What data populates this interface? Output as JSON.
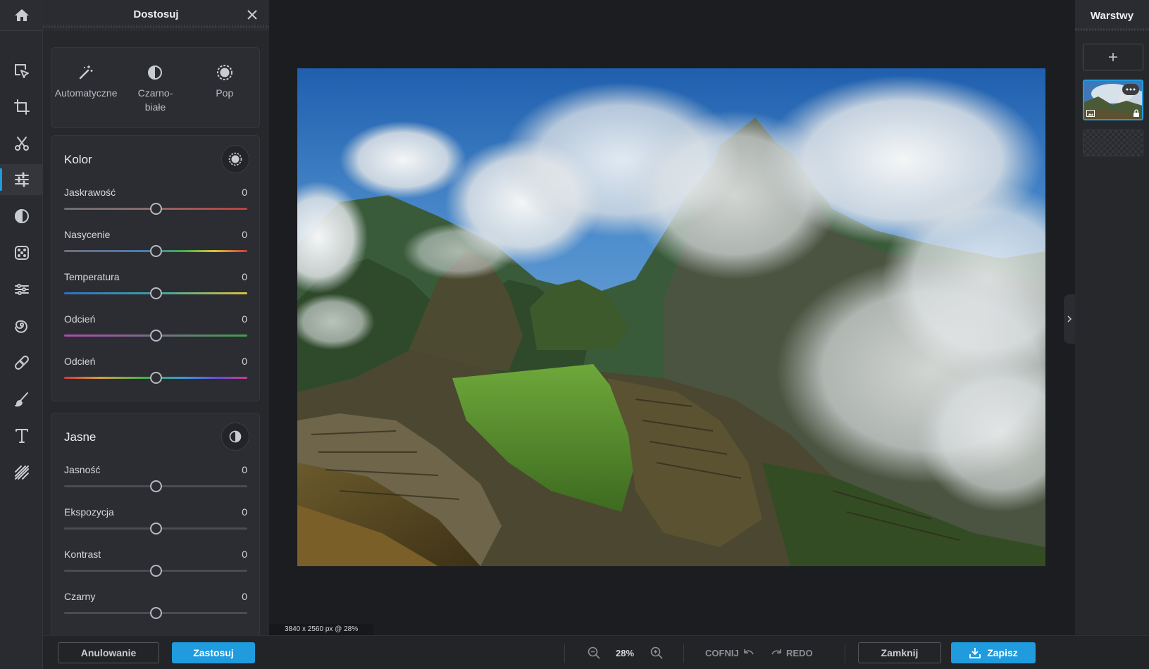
{
  "colors": {
    "accent": "#1f9bde",
    "panel": "#26282c",
    "canvas": "#1c1d21"
  },
  "rail": {
    "items": [
      {
        "icon": "home-icon"
      },
      {
        "icon": "select-arrow-icon"
      },
      {
        "icon": "crop-icon"
      },
      {
        "icon": "scissors-icon"
      },
      {
        "icon": "adjust-sliders-icon",
        "active": true
      },
      {
        "icon": "contrast-circle-icon"
      },
      {
        "icon": "effects-icon"
      },
      {
        "icon": "filters-icon"
      },
      {
        "icon": "liquify-swirl-icon"
      },
      {
        "icon": "bandage-icon"
      },
      {
        "icon": "brush-icon"
      },
      {
        "icon": "text-icon"
      },
      {
        "icon": "pattern-icon"
      }
    ]
  },
  "panel": {
    "title": "Dostosuj",
    "presets": [
      {
        "label": "Automatyczne",
        "icon": "magic-wand-icon"
      },
      {
        "label": "Czarno-białe",
        "line1": "Czarno-",
        "line2": "białe",
        "icon": "half-circle-icon"
      },
      {
        "label": "Pop",
        "icon": "sun-icon"
      }
    ],
    "color_section": {
      "title": "Kolor",
      "sliders": [
        {
          "name": "Jaskrawość",
          "value": "0",
          "level": 0.5,
          "gradient": "vibrance"
        },
        {
          "name": "Nasycenie",
          "value": "0",
          "level": 0.5,
          "gradient": "saturation"
        },
        {
          "name": "Temperatura",
          "value": "0",
          "level": 0.5,
          "gradient": "temperature"
        },
        {
          "name": "Odcień",
          "value": "0",
          "level": 0.5,
          "gradient": "tint"
        },
        {
          "name": "Odcień",
          "value": "0",
          "level": 0.5,
          "gradient": "hue"
        }
      ]
    },
    "light_section": {
      "title": "Jasne",
      "sliders": [
        {
          "name": "Jasność",
          "value": "0",
          "level": 0.5
        },
        {
          "name": "Ekspozycja",
          "value": "0",
          "level": 0.5
        },
        {
          "name": "Kontrast",
          "value": "0",
          "level": 0.5
        },
        {
          "name": "Czarny",
          "value": "0",
          "level": 0.5
        }
      ]
    }
  },
  "canvas": {
    "image_info": "3840 x 2560 px @ 28%"
  },
  "layers": {
    "title": "Warstwy"
  },
  "bottom": {
    "cancel": "Anulowanie",
    "apply": "Zastosuj",
    "zoom": "28%",
    "undo": "COFNIJ",
    "redo": "REDO",
    "close": "Zamknij",
    "save": "Zapisz"
  }
}
